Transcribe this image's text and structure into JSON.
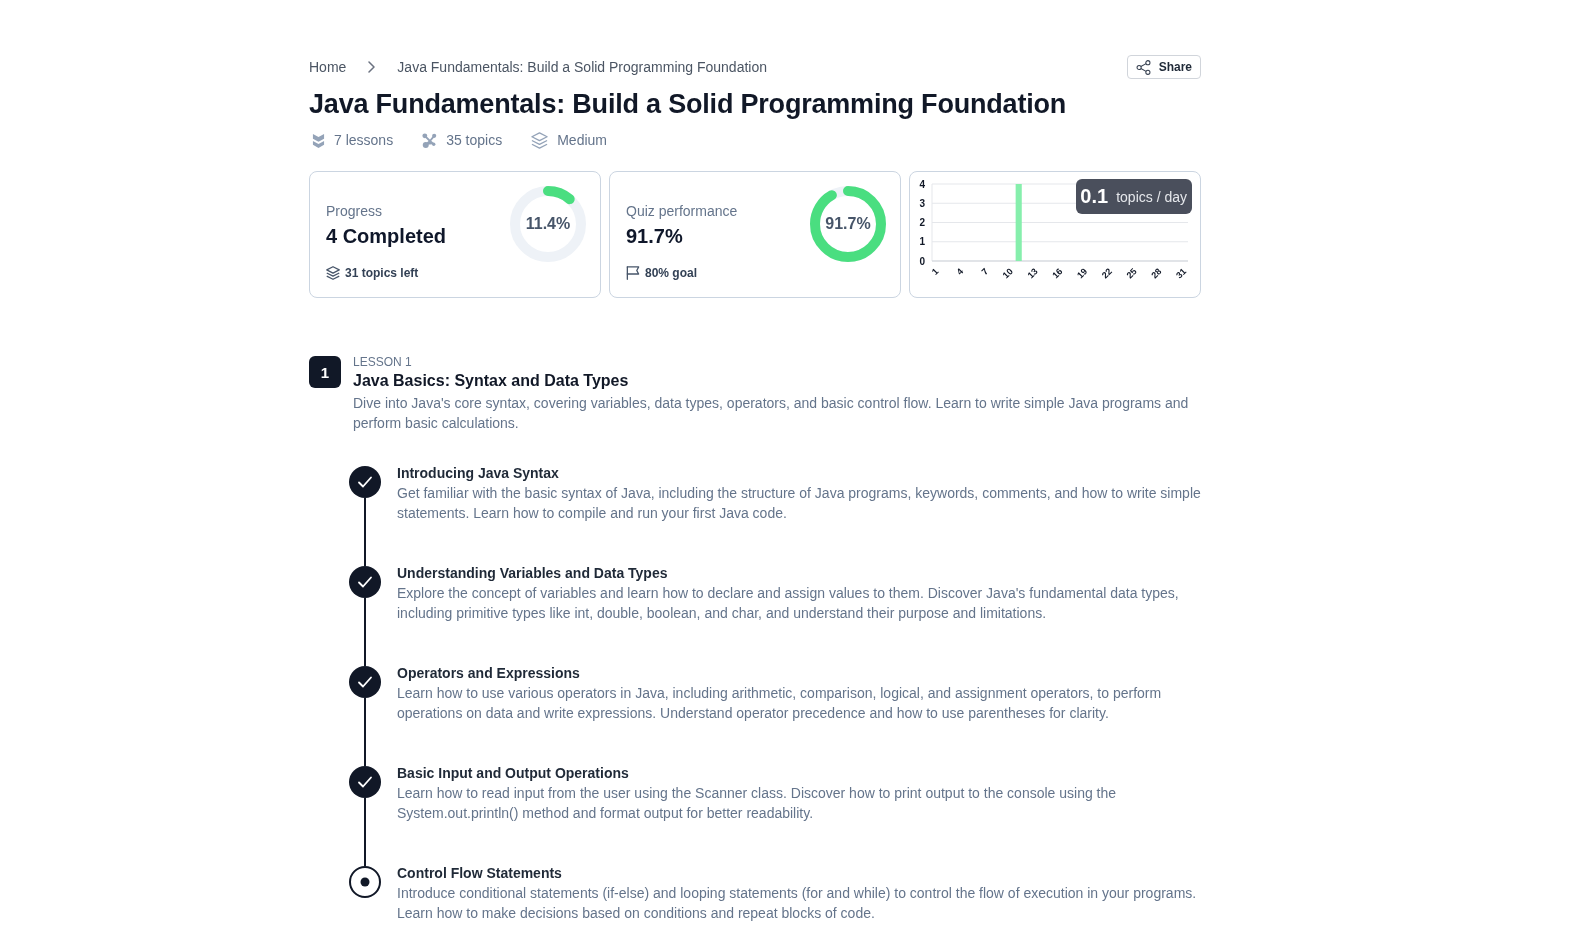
{
  "breadcrumb": [
    {
      "label": "Home"
    },
    {
      "label": "Java Fundamentals: Build a Solid Programming Foundation"
    }
  ],
  "share_button": {
    "label": "Share"
  },
  "title": "Java Fundamentals: Build a Solid Programming Foundation",
  "meta": [
    {
      "kind": "lessons",
      "label": "7 lessons"
    },
    {
      "kind": "topics",
      "label": "35 topics"
    },
    {
      "kind": "difficulty",
      "label": "Medium"
    }
  ],
  "stats": {
    "progress": {
      "label": "Progress",
      "value": "4 Completed",
      "ring_label": "11.4%",
      "level": 0.114,
      "footnote": "31 topics left"
    },
    "quiz": {
      "label": "Quiz performance",
      "value": "91.7%",
      "ring_label": "91.7%",
      "level": 0.917,
      "footnote": "80% goal"
    },
    "activity": {
      "rate": "0.1",
      "rate_unit": "topics / day",
      "chart_data": {
        "type": "bar",
        "x": [
          1,
          2,
          3,
          4,
          5,
          6,
          7,
          8,
          9,
          10,
          11,
          12,
          13,
          14,
          15,
          16,
          17,
          18,
          19,
          20,
          21,
          22,
          23,
          24,
          25,
          26,
          27,
          28,
          29,
          30,
          31
        ],
        "values": [
          0,
          0,
          0,
          0,
          0,
          0,
          0,
          0,
          0,
          0,
          4,
          0,
          0,
          0,
          0,
          0,
          0,
          0,
          0,
          0,
          0,
          0,
          0,
          0,
          0,
          0,
          0,
          0,
          0,
          0,
          0
        ],
        "xlim": [
          0.5,
          31.5
        ],
        "ylim": [
          0,
          4
        ],
        "yticks": [
          0,
          1,
          2,
          3,
          4
        ],
        "xticks": [
          1,
          4,
          7,
          10,
          13,
          16,
          19,
          22,
          25,
          28,
          31
        ],
        "grid": true
      }
    }
  },
  "lessons": [
    {
      "number": "1",
      "label": "LESSON 1",
      "title": "Java Basics: Syntax and Data Types",
      "description": "Dive into Java's core syntax, covering variables, data types, operators, and basic control flow. Learn to write simple Java programs and perform basic calculations.",
      "topics": [
        {
          "completed": true,
          "title": "Introducing Java Syntax",
          "description": "Get familiar with the basic syntax of Java, including the structure of Java programs, keywords, comments, and how to write simple statements. Learn how to compile and run your first Java code."
        },
        {
          "completed": true,
          "title": "Understanding Variables and Data Types",
          "description": "Explore the concept of variables and learn how to declare and assign values to them. Discover Java's fundamental data types, including primitive types like int, double, boolean, and char, and understand their purpose and limitations."
        },
        {
          "completed": true,
          "title": "Operators and Expressions",
          "description": "Learn how to use various operators in Java, including arithmetic, comparison, logical, and assignment operators, to perform operations on data and write expressions. Understand operator precedence and how to use parentheses for clarity."
        },
        {
          "completed": true,
          "title": "Basic Input and Output Operations",
          "description": "Learn how to read input from the user using the Scanner class. Discover how to print output to the console using the System.out.println() method and format output for better readability."
        },
        {
          "completed": false,
          "title": "Control Flow Statements",
          "description": "Introduce conditional statements (if-else) and looping statements (for and while) to control the flow of execution in your programs. Learn how to make decisions based on conditions and repeat blocks of code."
        }
      ]
    }
  ]
}
